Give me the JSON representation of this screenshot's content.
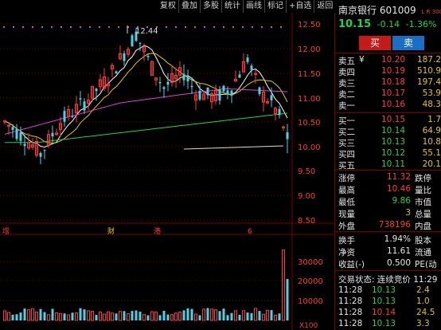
{
  "toolbar": [
    "复权",
    "叠加",
    "多股",
    "统计",
    "画线",
    "标记",
    "+自选",
    "返回"
  ],
  "chart": {
    "price_axis": [
      "12.50",
      "12.00",
      "11.50",
      "11.00",
      "10.50",
      "10.00",
      "9.50",
      "9.00",
      "8.50"
    ],
    "vol_axis": [
      "30000",
      "20000",
      "10000",
      "X100"
    ],
    "high_marker": "12.44",
    "events": [
      "增",
      "财",
      "港",
      "6"
    ],
    "colors": {
      "up": "#ff3b3b",
      "down": "#4fd0e6",
      "ma5": "#ffffff",
      "ma10": "#e6c800",
      "ma20": "#e040e0",
      "ma60": "#21d44e",
      "grid": "#7a0000"
    }
  },
  "stock": {
    "name": "南京银行",
    "code": "601009",
    "lr": "L R 300",
    "price": "10.15",
    "change": "-0.14",
    "pct": "-1.36%"
  },
  "buttons": {
    "buy": "买",
    "sell": "卖"
  },
  "sell_orders": [
    {
      "label": "卖五",
      "cur": "¥",
      "price": "10.20",
      "vol": "187.2"
    },
    {
      "label": "卖四",
      "price": "10.19",
      "vol": "510.9"
    },
    {
      "label": "卖三",
      "price": "10.18",
      "vol": "197.4"
    },
    {
      "label": "卖二",
      "price": "10.17",
      "vol": "53.9"
    },
    {
      "label": "卖一",
      "price": "10.16",
      "vol": "48.3"
    }
  ],
  "buy_orders": [
    {
      "label": "买一",
      "price": "10.15",
      "vol": "1.7"
    },
    {
      "label": "买二",
      "price": "10.14",
      "vol": "64.9"
    },
    {
      "label": "买三",
      "price": "10.13",
      "vol": "10.8"
    },
    {
      "label": "买四",
      "price": "10.12",
      "vol": "55.1"
    },
    {
      "label": "买五",
      "price": "10.11",
      "vol": "20.1"
    }
  ],
  "stats1": [
    {
      "l": "涨停",
      "v": "11.32",
      "l2": "跌停"
    },
    {
      "l": "最高",
      "v": "10.46",
      "l2": "量比"
    },
    {
      "l": "最低",
      "v": "9.86",
      "l2": "市值"
    },
    {
      "l": "现量",
      "v": "3",
      "l2": "总量"
    },
    {
      "l": "外盘",
      "v": "738196",
      "l2": "内盘"
    }
  ],
  "stats2": [
    {
      "l": "换手",
      "v": "1.94%",
      "l2": "股本"
    },
    {
      "l": "净资",
      "v": "11.61",
      "l2": "流通"
    },
    {
      "l": "收益(-)",
      "v": "0.500",
      "l2": "PE(动"
    }
  ],
  "trade_status": "交易状态: 连续竞价 11:29",
  "ticks": [
    {
      "t": "11:28",
      "p": "10.13",
      "v": "2.4"
    },
    {
      "t": "11:28",
      "p": "10.13",
      "v": "1.0"
    },
    {
      "t": "11:28",
      "p": "10.14",
      "v": "24.5"
    },
    {
      "t": "11:28",
      "p": "10.13",
      "v": "3.3"
    }
  ]
}
